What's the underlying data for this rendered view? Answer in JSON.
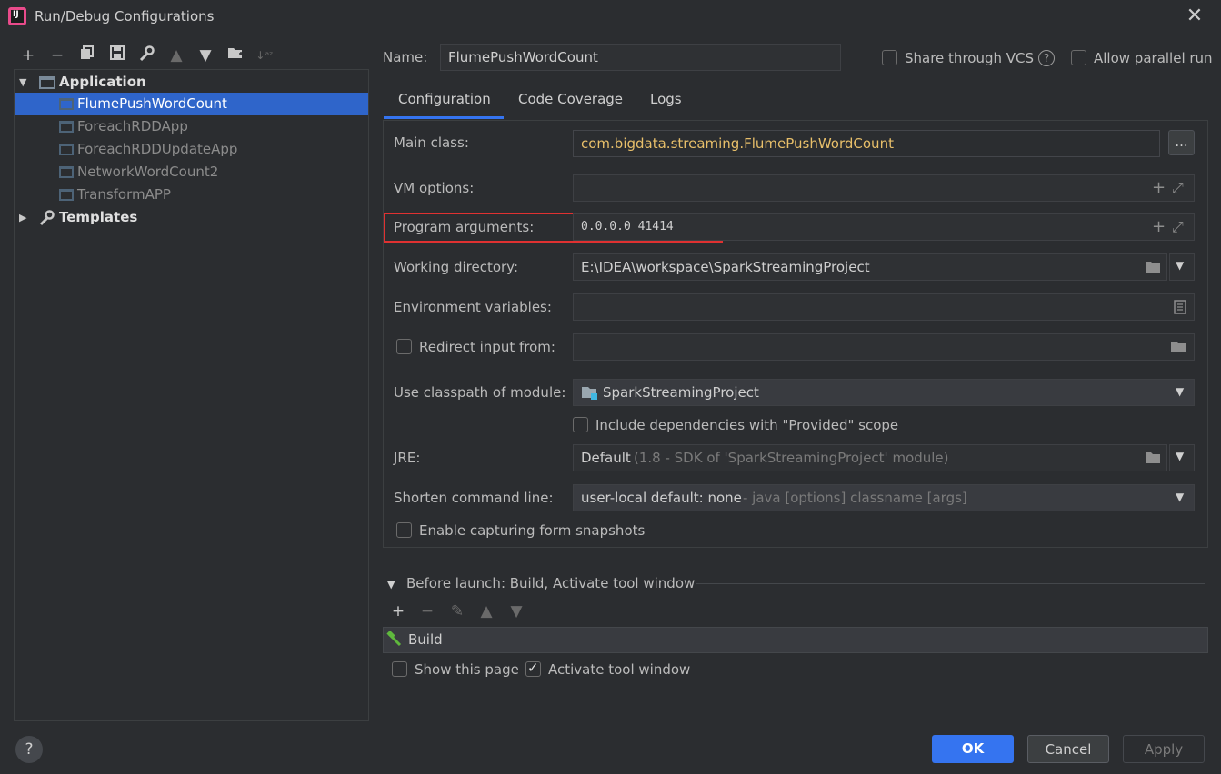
{
  "window": {
    "title": "Run/Debug Configurations",
    "app_icon_text": "IJ"
  },
  "toolbar": {
    "icons": [
      "add-icon",
      "remove-icon",
      "copy-icon",
      "save-icon",
      "wrench-icon",
      "move-up-icon",
      "move-down-icon",
      "new-folder-icon",
      "sort-icon"
    ]
  },
  "tree": {
    "application_label": "Application",
    "items": [
      {
        "label": "FlumePushWordCount",
        "selected": true
      },
      {
        "label": "ForeachRDDApp"
      },
      {
        "label": "ForeachRDDUpdateApp"
      },
      {
        "label": "NetworkWordCount2"
      },
      {
        "label": "TransformAPP"
      }
    ],
    "templates_label": "Templates"
  },
  "header": {
    "name_label": "Name:",
    "name_value": "FlumePushWordCount",
    "share_vcs_label": "Share through VCS",
    "allow_parallel_label": "Allow parallel run"
  },
  "tabs": [
    "Configuration",
    "Code Coverage",
    "Logs"
  ],
  "config": {
    "main_class_label": "Main class:",
    "main_class_value": "com.bigdata.streaming.FlumePushWordCount",
    "browse_label": "...",
    "vm_options_label": "VM options:",
    "vm_options_value": "",
    "program_args_label": "Program arguments:",
    "program_args_value": "0.0.0.0 41414",
    "working_dir_label": "Working directory:",
    "working_dir_value": "E:\\IDEA\\workspace\\SparkStreamingProject",
    "env_vars_label": "Environment variables:",
    "redirect_label": "Redirect input from:",
    "classpath_label": "Use classpath of module:",
    "classpath_value": "SparkStreamingProject",
    "include_deps_label": "Include dependencies with \"Provided\" scope",
    "jre_label": "JRE:",
    "jre_value": "Default",
    "jre_hint": "(1.8 - SDK of 'SparkStreamingProject' module)",
    "shorten_label": "Shorten command line:",
    "shorten_value": "user-local default: none",
    "shorten_hint": "- java [options] classname [args]",
    "enable_capture_label": "Enable capturing form snapshots"
  },
  "before_launch": {
    "title": "Before launch: Build, Activate tool window",
    "task_label": "Build",
    "show_page_label": "Show this page",
    "activate_label": "Activate tool window"
  },
  "footer": {
    "help_label": "?",
    "ok_label": "OK",
    "cancel_label": "Cancel",
    "apply_label": "Apply"
  },
  "colors": {
    "accent": "#3574f0",
    "selection": "#2f65ca",
    "highlight_border": "#e03131",
    "main_class_text": "#e8bf6a"
  }
}
